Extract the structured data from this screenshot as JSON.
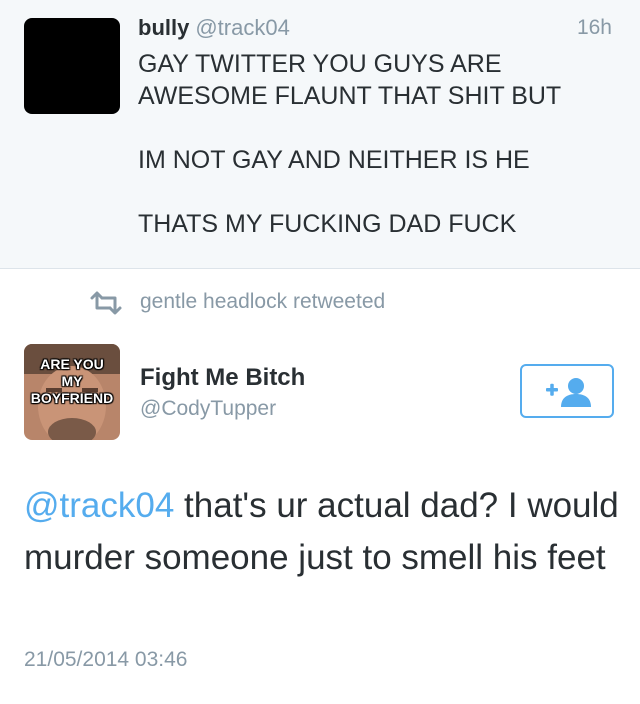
{
  "original_tweet": {
    "name": "bully",
    "handle": "@track04",
    "time": "16h",
    "text": "GAY TWITTER YOU GUYS ARE\nAWESOME FLAUNT THAT SHIT BUT\n\nIM NOT GAY AND NEITHER IS HE\n\nTHATS MY FUCKING DAD FUCK"
  },
  "retweet_bar": {
    "label": "gentle headlock retweeted"
  },
  "focused_tweet": {
    "avatar_caption": [
      "ARE YOU",
      "MY",
      "BOYFRIEND"
    ],
    "name": "Fight Me Bitch",
    "handle": "@CodyTupper",
    "follow_icon": "add-user-icon",
    "mention": "@track04",
    "text": " that's ur actual dad? I would murder someone just to smell his feet",
    "timestamp": "21/05/2014 03:46"
  },
  "colors": {
    "accent": "#55acee",
    "text": "#292f33",
    "muted": "#8899a6",
    "top_background": "#f5f8fa"
  }
}
